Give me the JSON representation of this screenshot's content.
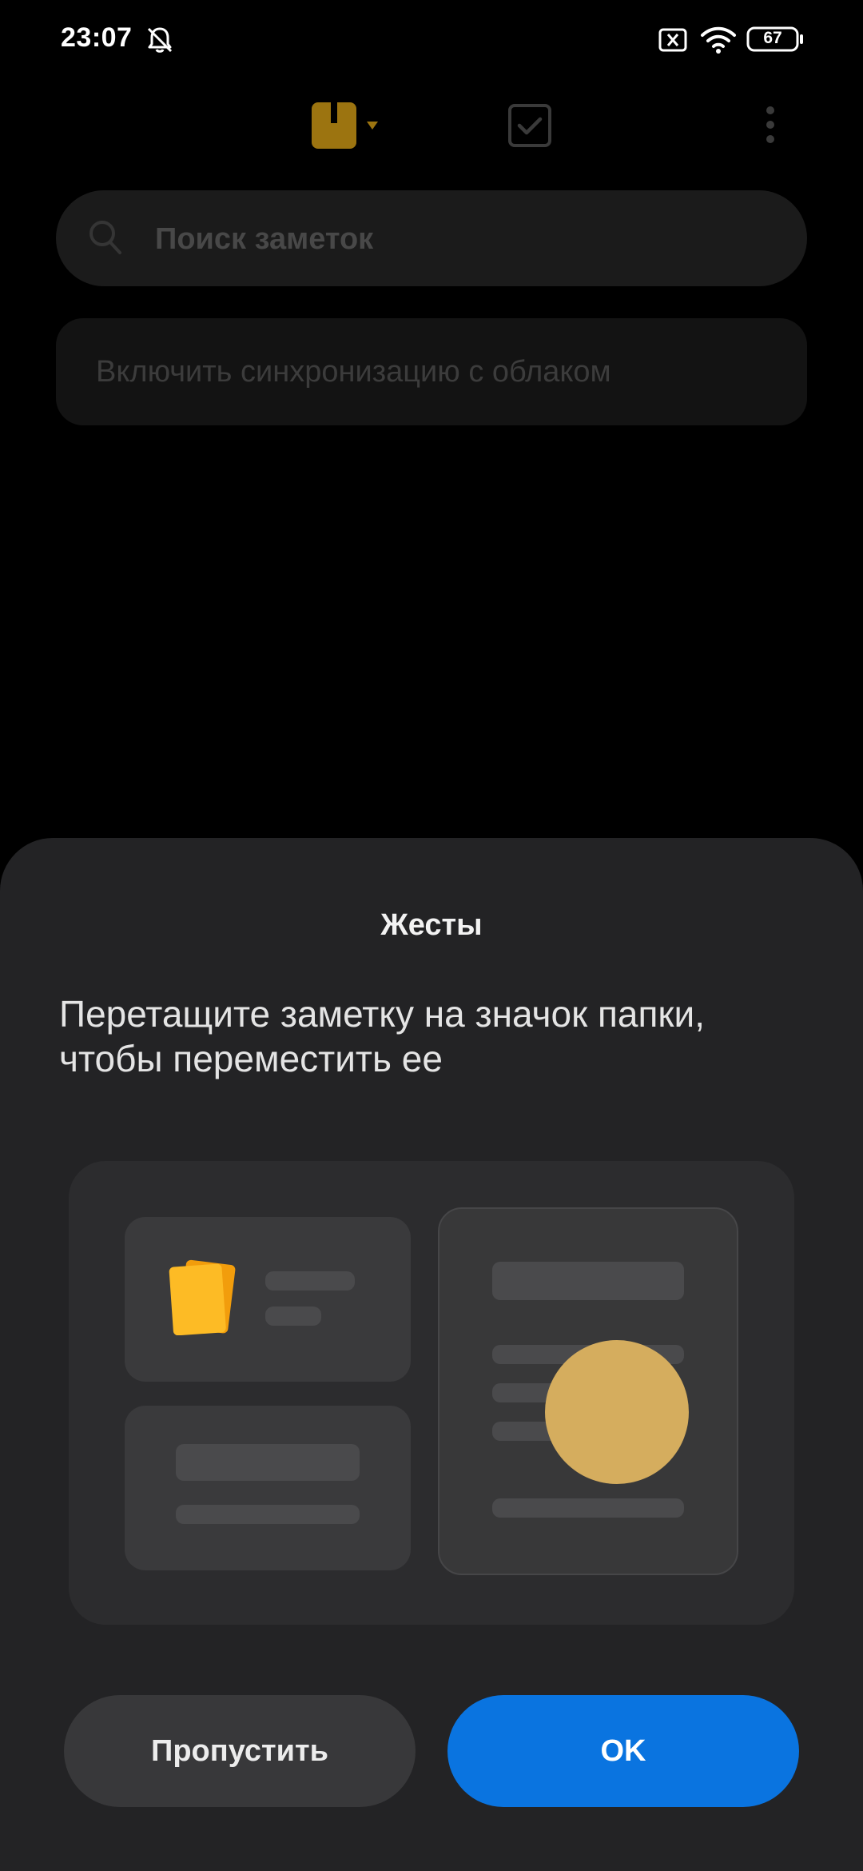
{
  "status_bar": {
    "time": "23:07",
    "battery": "67",
    "icons": [
      "bell-off-icon",
      "no-sim-icon",
      "wifi-icon",
      "battery-icon"
    ]
  },
  "toolbar": {
    "icons": [
      "folder-icon",
      "chevron-down-icon",
      "checklist-icon",
      "more-vert-icon"
    ],
    "accent_color": "#9c7410"
  },
  "search": {
    "placeholder": "Поиск заметок"
  },
  "sync_banner": {
    "text": "Включить синхронизацию с облаком"
  },
  "gesture_sheet": {
    "title": "Жесты",
    "description": "Перетащите заметку на значок папки, чтобы переместить ее",
    "illustration_icons": [
      "notes-stack-icon",
      "touch-indicator-icon"
    ],
    "skip_label": "Пропустить",
    "ok_label": "OK",
    "colors": {
      "sheet_bg": "#232325",
      "ok_button": "#0a74e0",
      "note_yellow": "#fdbb25",
      "touch_dot": "#d5ad5e"
    }
  }
}
